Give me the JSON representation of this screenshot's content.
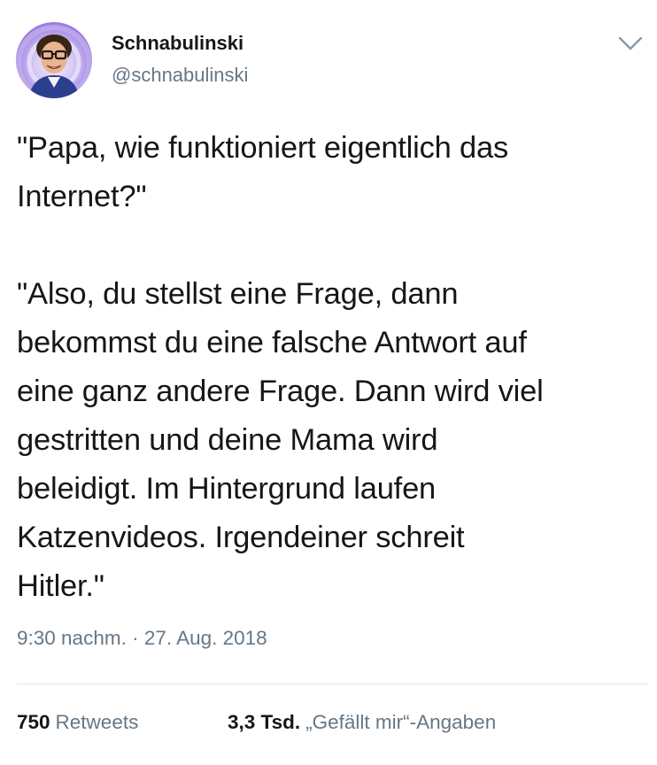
{
  "author": {
    "name": "Schnabulinski",
    "handle": "@schnabulinski",
    "avatar_icon": "avatar-portrait"
  },
  "menu": {
    "icon": "chevron-down-icon"
  },
  "tweet": {
    "text": "\"Papa, wie funktioniert eigentlich das\nInternet?\"\n\n\"Also, du stellst eine Frage, dann\nbekommst du eine falsche Antwort auf\neine ganz andere Frage. Dann wird viel\ngestritten und deine Mama wird\nbeleidigt. Im Hintergrund laufen\nKatzenvideos. Irgendeiner schreit\nHitler.\"",
    "timestamp": "9:30 nachm. · 27. Aug. 2018"
  },
  "stats": {
    "retweets_count": "750",
    "retweets_label": "Retweets",
    "likes_count": "3,3 Tsd.",
    "likes_label": "„Gefällt mir“-Angaben"
  },
  "colors": {
    "text": "#14171a",
    "secondary": "#657786",
    "divider": "#e1e8ed"
  }
}
